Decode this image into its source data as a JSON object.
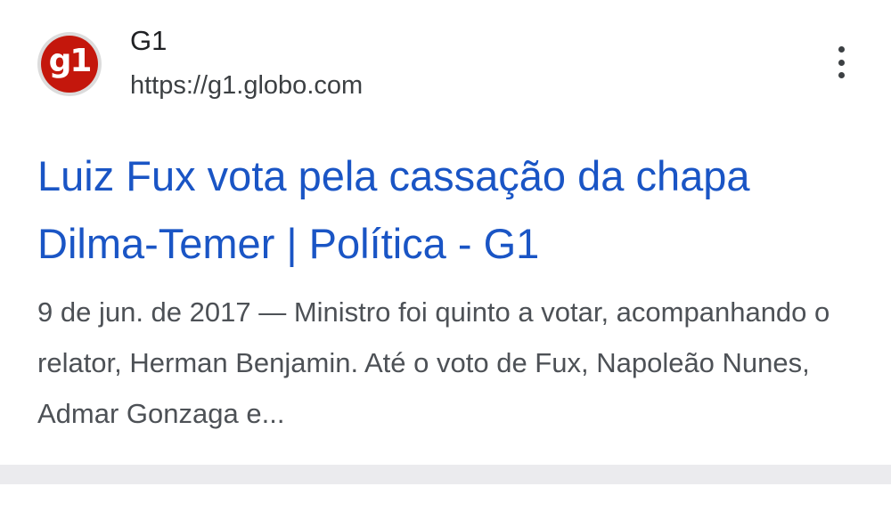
{
  "result": {
    "site_name": "G1",
    "site_url": "https://g1.globo.com",
    "logo_text": "g1",
    "title": "Luiz Fux vota pela cassação da chapa Dilma-Temer | Política - G1",
    "date": "9 de jun. de 2017",
    "separator": " — ",
    "snippet": "Ministro foi quinto a votar, acompanhando o relator, Herman Benjamin. Até o voto de Fux, Napoleão Nunes, Admar Gonzaga e..."
  },
  "icons": {
    "logo": "g1-logo-icon",
    "more": "more-vert-icon"
  },
  "colors": {
    "title_link": "#1a55c5",
    "logo_red": "#c4170c",
    "snippet_text": "#4d5156"
  }
}
